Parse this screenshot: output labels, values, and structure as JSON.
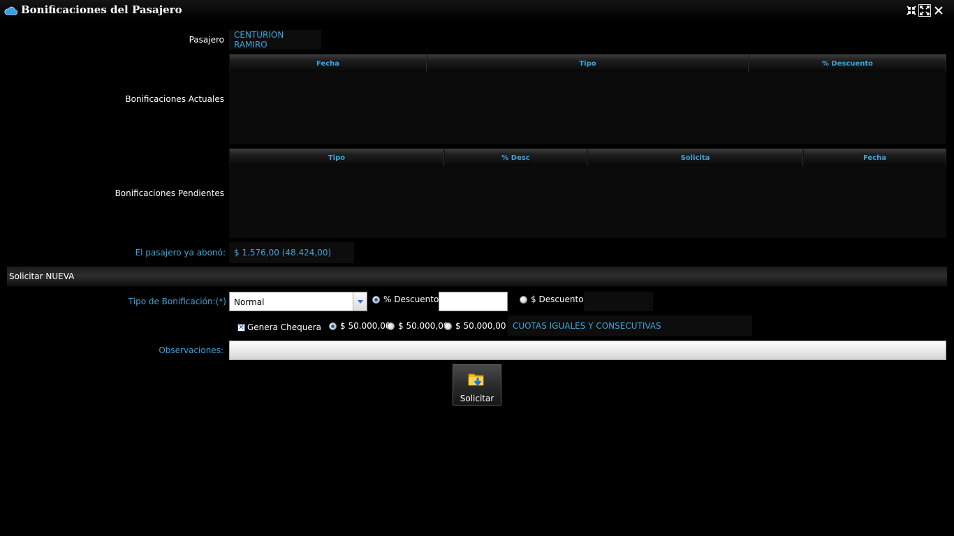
{
  "window": {
    "title": "Bonificaciones del Pasajero",
    "icons": [
      "cloud-icon",
      "restore-icon",
      "maximize-icon",
      "close-icon"
    ]
  },
  "pasajero": {
    "label": "Pasajero",
    "value": "CENTURION RAMIRO"
  },
  "actuales": {
    "label": "Bonificaciones Actuales",
    "columns": [
      "Fecha",
      "Tipo",
      "% Descuento"
    ],
    "rows": []
  },
  "pendientes": {
    "label": "Bonificaciones Pendientes",
    "columns": [
      "Tipo",
      "% Desc",
      "Solicita",
      "Fecha"
    ],
    "rows": []
  },
  "abono": {
    "label": "El pasajero ya abonó:",
    "value": "$ 1.576,00 (48.424,00)"
  },
  "nueva": {
    "section_label": "Solicitar NUEVA",
    "tipo_label": "Tipo de Bonificación:(*)",
    "tipo_value": "Normal",
    "pct_descuento_label": "% Descuento",
    "pct_descuento_checked": true,
    "pct_descuento_value": "",
    "monto_descuento_label": "$ Descuento",
    "monto_descuento_checked": false,
    "monto_descuento_value": "",
    "genera_chequera_label": "Genera Chequera",
    "genera_chequera_checked": true,
    "chequera_options": [
      {
        "label": "$ 50.000,00",
        "checked": true
      },
      {
        "label": "$ 50.000,00",
        "checked": false
      },
      {
        "label": "$ 50.000,00",
        "checked": false
      }
    ],
    "cuotas_text": "CUOTAS IGUALES Y CONSECUTIVAS",
    "observaciones_label": "Observaciones:",
    "observaciones_value": "",
    "submit_label": "Solicitar"
  },
  "colors": {
    "accent": "#3ba5db",
    "background": "#000000"
  }
}
